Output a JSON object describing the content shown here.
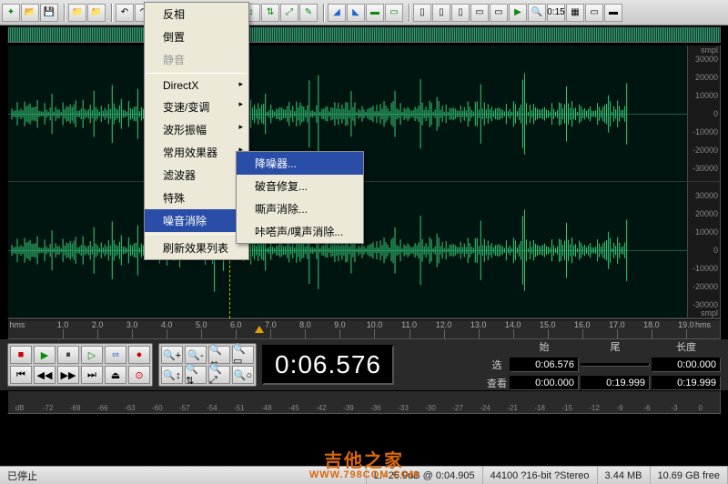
{
  "toolbar": {
    "groups": [
      [
        "new",
        "open",
        "save"
      ],
      [
        "prev",
        "next"
      ],
      [
        "undo",
        "redo"
      ],
      [
        "copy",
        "cut",
        "paste",
        "mix"
      ],
      [
        "trim",
        "sel",
        "crop",
        "mark",
        "zoom"
      ],
      [
        "fx1",
        "fx2",
        "fx3",
        "fx4"
      ],
      [
        "v1",
        "v2",
        "v3",
        "v4",
        "v5",
        "play",
        "stop",
        "zoom2",
        "time",
        "grid",
        "win",
        "close"
      ]
    ]
  },
  "menu": {
    "items": [
      {
        "label": "反相",
        "type": "item"
      },
      {
        "label": "倒置",
        "type": "item"
      },
      {
        "label": "静音",
        "type": "item",
        "disabled": true
      },
      {
        "type": "sep"
      },
      {
        "label": "DirectX",
        "type": "sub"
      },
      {
        "label": "变速/变调",
        "type": "sub"
      },
      {
        "label": "波形振幅",
        "type": "sub"
      },
      {
        "label": "常用效果器",
        "type": "sub"
      },
      {
        "label": "滤波器",
        "type": "sub"
      },
      {
        "label": "特殊",
        "type": "sub"
      },
      {
        "label": "噪音消除",
        "type": "sub",
        "hover": true
      },
      {
        "type": "sep"
      },
      {
        "label": "刷新效果列表",
        "type": "item"
      }
    ],
    "submenu": [
      {
        "label": "降噪器...",
        "hover": true
      },
      {
        "label": "破音修复...",
        "hover": false
      },
      {
        "label": "嘶声消除...",
        "hover": false
      },
      {
        "label": "咔嗒声/噗声消除...",
        "hover": false
      }
    ]
  },
  "ruler_y": {
    "unit": "smpl",
    "ticks": [
      "30000",
      "20000",
      "10000",
      "0",
      "-10000",
      "-20000",
      "-30000"
    ]
  },
  "time_ruler": {
    "unit": "hms",
    "ticks": [
      "1.0",
      "2.0",
      "3.0",
      "4.0",
      "5.0",
      "6.0",
      "7.0",
      "8.0",
      "9.0",
      "10.0",
      "11.0",
      "12.0",
      "13.0",
      "14.0",
      "15.0",
      "16.0",
      "17.0",
      "18.0",
      "19.0"
    ]
  },
  "cursor_time_fraction": 0.325,
  "transport": {
    "time": "0:06.576",
    "headers": {
      "start": "始",
      "end": "尾",
      "length": "长度"
    },
    "rows": {
      "sel": {
        "label": "选",
        "start": "0:06.576",
        "end": "",
        "length": "0:00.000"
      },
      "view": {
        "label": "查看",
        "start": "0:00.000",
        "end": "0:19.999",
        "length": "0:19.999"
      }
    }
  },
  "level_scale": [
    "dB",
    "-72",
    "-69",
    "-66",
    "-63",
    "-60",
    "-57",
    "-54",
    "-51",
    "-48",
    "-45",
    "-42",
    "-39",
    "-36",
    "-33",
    "-30",
    "-27",
    "-24",
    "-21",
    "-18",
    "-15",
    "-12",
    "-9",
    "-6",
    "-3",
    "0"
  ],
  "status": {
    "state": "已停止",
    "lr": "L: -26.9dB @ 0:04.905",
    "format": "44100 ?16-bit ?Stereo",
    "size": "3.44 MB",
    "free": "10.69 GB free"
  },
  "watermark": {
    "line1": "吉他之家",
    "line2": "WWW.798COM.COM"
  }
}
